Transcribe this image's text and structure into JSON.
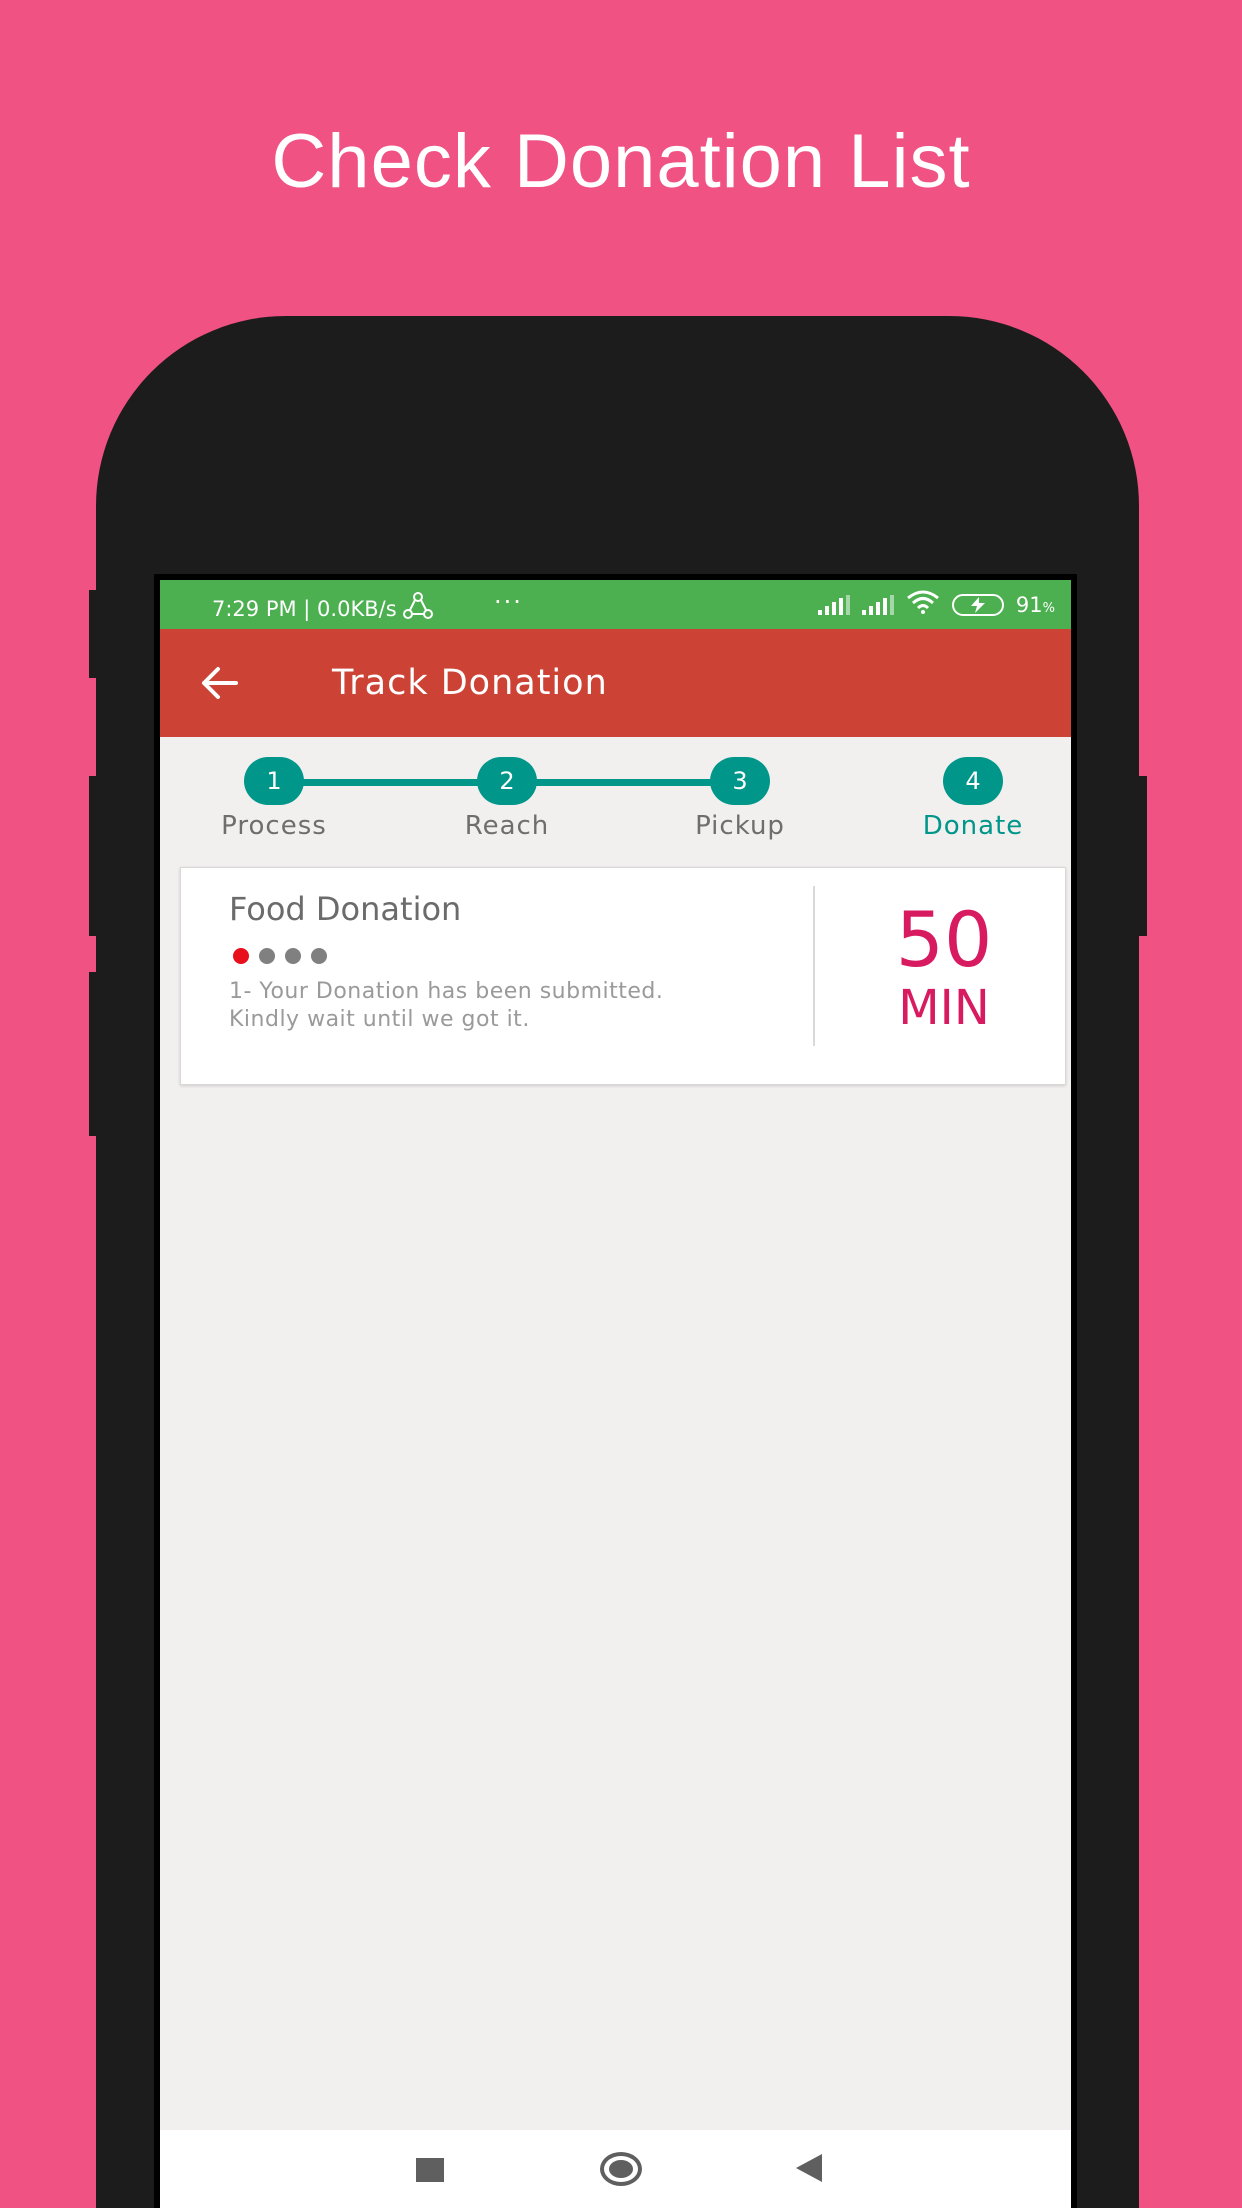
{
  "headline": "Check Donation List",
  "statusbar": {
    "time_and_speed": "7:29 PM | 0.0KB/s",
    "dots": "···",
    "battery": "91",
    "battery_unit": "%"
  },
  "appbar": {
    "title": "Track Donation",
    "back_icon": "arrow-left-icon"
  },
  "stepper": {
    "steps": [
      {
        "number": "1",
        "label": "Process",
        "active": false
      },
      {
        "number": "2",
        "label": "Reach",
        "active": false
      },
      {
        "number": "3",
        "label": "Pickup",
        "active": false
      },
      {
        "number": "4",
        "label": "Donate",
        "active": true
      }
    ]
  },
  "card": {
    "title": "Food Donation",
    "progress_dots_total": 4,
    "progress_dots_active": 1,
    "message_line1": "1- Your Donation has been submitted.",
    "message_line2": "Kindly wait until we got it.",
    "time_value": "50",
    "time_unit": "MIN"
  },
  "navbar": {
    "items": [
      "recents-icon",
      "home-icon",
      "back-icon"
    ]
  },
  "colors": {
    "background": "#f05283",
    "statusbar": "#4caf50",
    "appbar": "#cc4335",
    "accent": "#00968a",
    "time": "#d81b60",
    "active_dot": "#e8101c"
  }
}
